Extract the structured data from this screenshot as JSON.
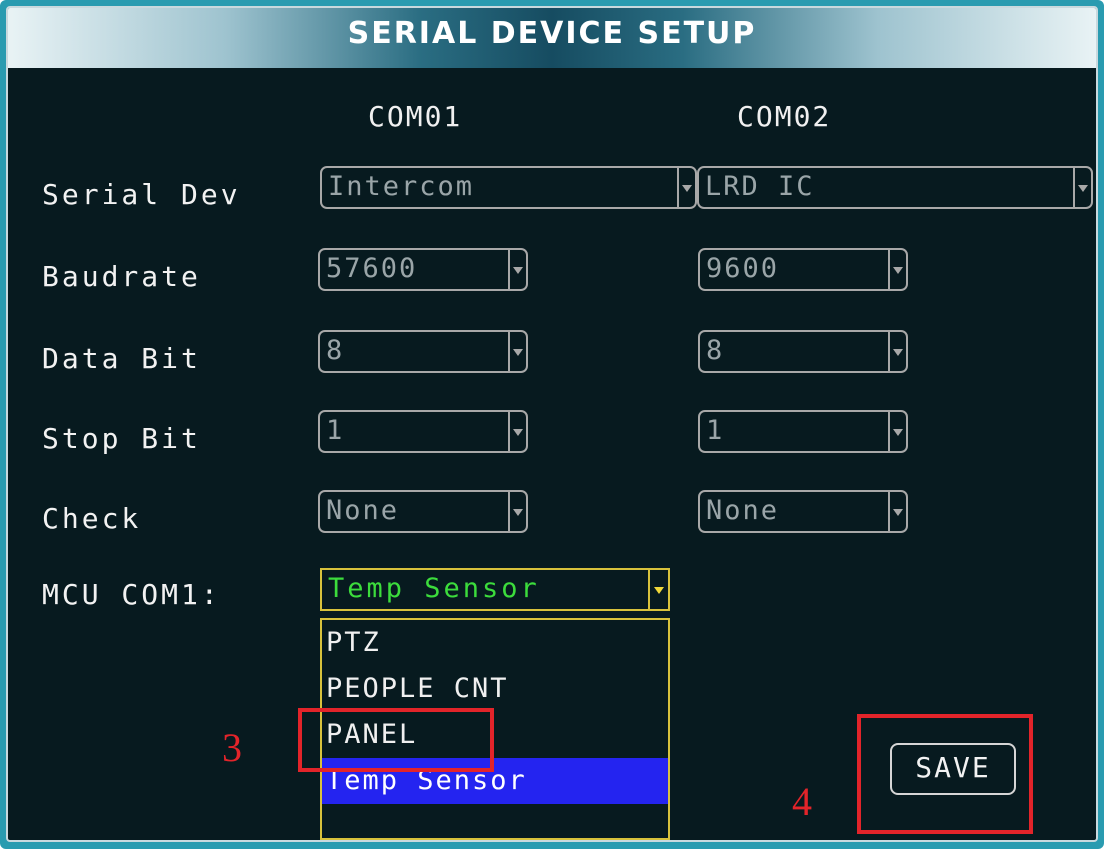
{
  "window": {
    "title": "SERIAL DEVICE SETUP"
  },
  "columns": [
    "COM01",
    "COM02"
  ],
  "rows": [
    {
      "label": "Serial Dev",
      "com01": "Intercom",
      "com02": "LRD IC"
    },
    {
      "label": "Baudrate",
      "com01": "57600",
      "com02": "9600"
    },
    {
      "label": "Data Bit",
      "com01": "8",
      "com02": "8"
    },
    {
      "label": "Stop Bit",
      "com01": "1",
      "com02": "1"
    },
    {
      "label": "Check",
      "com01": "None",
      "com02": "None"
    }
  ],
  "mcu": {
    "label": "MCU COM1:",
    "value": "Temp Sensor",
    "options": [
      "PTZ",
      "PEOPLE CNT",
      "PANEL",
      "Temp Sensor"
    ],
    "selected_option": "Temp Sensor"
  },
  "save_label": "SAVE",
  "annotations": {
    "step3": "3",
    "step4": "4"
  },
  "colors": {
    "panel_bg": "#071a1f",
    "frame": "#2a9bb0",
    "mcu_text": "#3cdc3c",
    "mcu_border": "#d8c23c",
    "selected_option_bg": "#2424f0",
    "annotation_red": "#e2242a"
  },
  "icons": {
    "dropdown": "chevron-down-icon"
  }
}
